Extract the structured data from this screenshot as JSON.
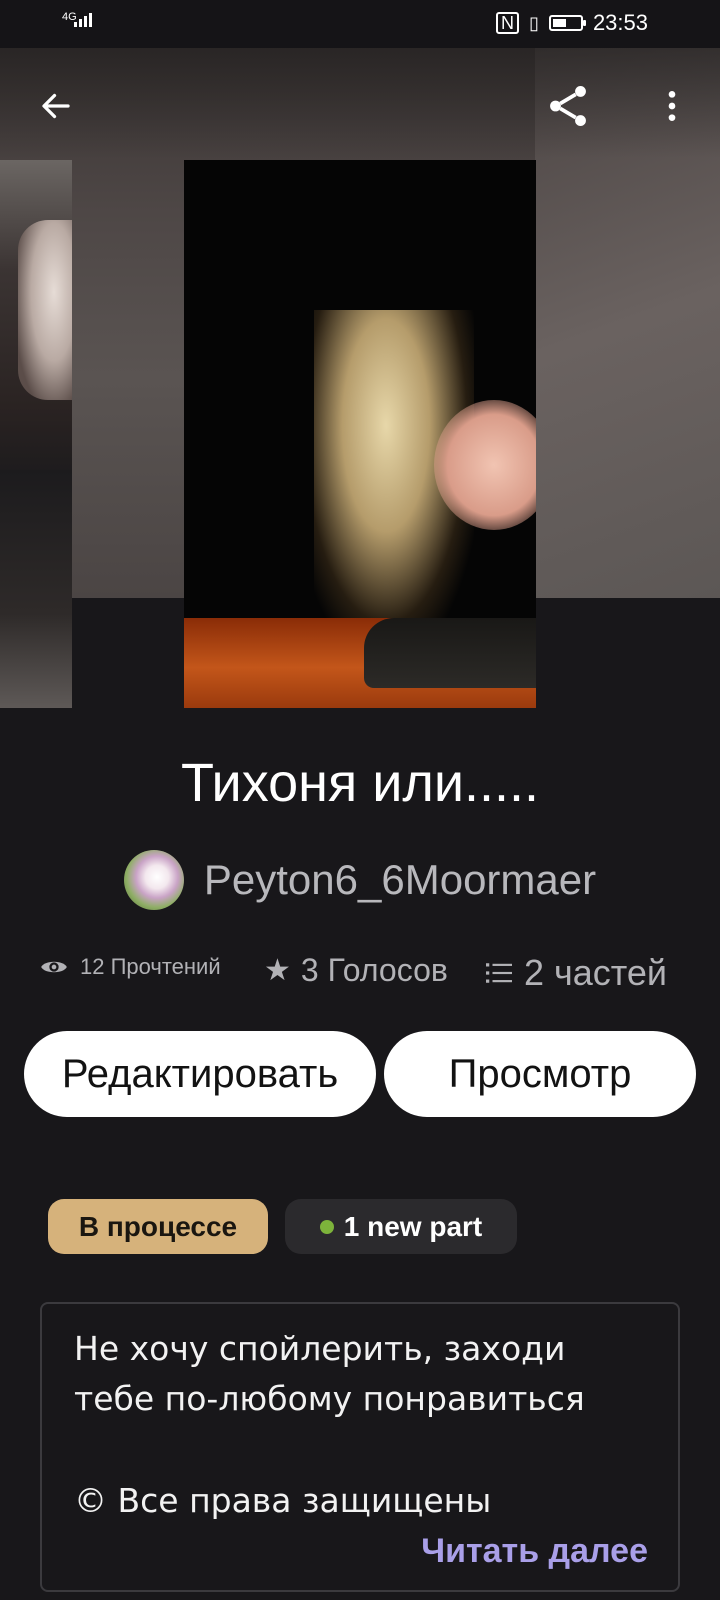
{
  "status_bar": {
    "network": "4G",
    "time": "23:53",
    "battery_level": 0.45
  },
  "hero": {
    "back_icon": "arrow-left-icon",
    "share_icon": "share-icon",
    "more_icon": "more-vertical-icon"
  },
  "story": {
    "title": "Тихоня или.....",
    "author": "Peyton6_6Moormaer"
  },
  "stats": {
    "reads": "12 Прочтений",
    "votes": "3 Голосов",
    "parts": "2 частей"
  },
  "actions": {
    "edit_label": "Редактировать",
    "preview_label": "Просмотр"
  },
  "badges": {
    "status": "В процессе",
    "new_part": "1 new part",
    "status_color": "#d6b27b",
    "new_dot_color": "#7db33b"
  },
  "description": {
    "line1": "Не хочу спойлерить, заходи",
    "line2": "тебе по-любому понравиться",
    "line3": "© Все права защищены",
    "read_more": "Читать далее"
  }
}
